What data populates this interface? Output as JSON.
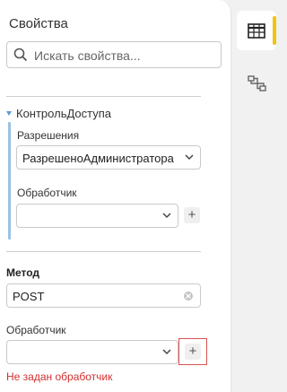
{
  "panel": {
    "title": "Свойства"
  },
  "search": {
    "placeholder": "Искать свойства..."
  },
  "access_group": {
    "title": "КонтрольДоступа",
    "permissions_label": "Разрешения",
    "permissions_value": "РазрешеноАдминистратора",
    "handler_label": "Обработчик",
    "handler_value": ""
  },
  "method": {
    "label": "Метод",
    "value": "POST",
    "handler_label": "Обработчик",
    "handler_value": "",
    "error_text": "Не задан обработчик"
  },
  "buttons": {
    "add": "+"
  },
  "sidebar": {
    "items": [
      {
        "icon": "table-icon",
        "active": true
      },
      {
        "icon": "flow-icon",
        "active": false
      }
    ]
  },
  "colors": {
    "accent": "#f1c40f",
    "error": "#d32f2f",
    "highlight_border": "#d9534f",
    "group_bar": "#9bc2e6"
  }
}
